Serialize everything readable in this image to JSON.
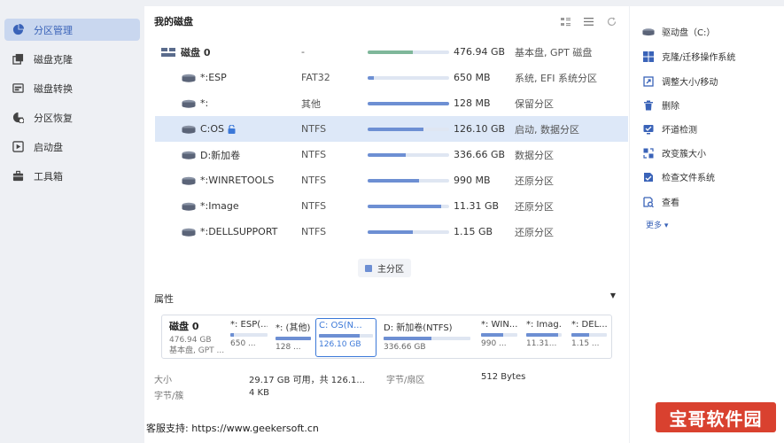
{
  "sidebar": {
    "items": [
      {
        "label": "分区管理",
        "icon": "pie-chart-icon",
        "active": true
      },
      {
        "label": "磁盘克隆",
        "icon": "clone-icon",
        "active": false
      },
      {
        "label": "磁盘转换",
        "icon": "convert-icon",
        "active": false
      },
      {
        "label": "分区恢复",
        "icon": "recover-icon",
        "active": false
      },
      {
        "label": "启动盘",
        "icon": "boot-disk-icon",
        "active": false
      },
      {
        "label": "工具箱",
        "icon": "toolbox-icon",
        "active": false
      }
    ]
  },
  "main": {
    "title": "我的磁盘",
    "toolbar_icons": [
      "grid-view-icon",
      "list-view-icon",
      "refresh-icon"
    ],
    "disk": {
      "name": "磁盘 0",
      "fs": "-",
      "size": "476.94 GB",
      "type": "基本盘, GPT 磁盘",
      "usage": 0.55
    },
    "partitions": [
      {
        "name": "*:ESP",
        "fs": "FAT32",
        "size": "650 MB",
        "type": "系统, EFI 系统分区",
        "usage": 0.08,
        "locked": false
      },
      {
        "name": "*:",
        "fs": "其他",
        "size": "128 MB",
        "type": "保留分区",
        "usage": 1.0,
        "locked": false
      },
      {
        "name": "C:OS",
        "fs": "NTFS",
        "size": "126.10 GB",
        "type": "启动, 数据分区",
        "usage": 0.68,
        "locked": true
      },
      {
        "name": "D:新加卷",
        "fs": "NTFS",
        "size": "336.66 GB",
        "type": "数据分区",
        "usage": 0.47,
        "locked": false
      },
      {
        "name": "*:WINRETOOLS",
        "fs": "NTFS",
        "size": "990 MB",
        "type": "还原分区",
        "usage": 0.63,
        "locked": false
      },
      {
        "name": "*:Image",
        "fs": "NTFS",
        "size": "11.31 GB",
        "type": "还原分区",
        "usage": 0.9,
        "locked": false
      },
      {
        "name": "*:DELLSUPPORT",
        "fs": "NTFS",
        "size": "1.15 GB",
        "type": "还原分区",
        "usage": 0.55,
        "locked": false
      }
    ],
    "legend": "主分区",
    "properties_title": "属性",
    "diskmap": {
      "disk": {
        "name": "磁盘 0",
        "size": "476.94 GB",
        "type": "基本盘, GPT ..."
      },
      "parts": [
        {
          "label": "*: ESP(...",
          "size": "650 ...",
          "usage": 0.1
        },
        {
          "label": "*: (其他)",
          "size": "128 ...",
          "usage": 1.0
        },
        {
          "label": "C: OS(N...",
          "size": "126.10 GB",
          "usage": 0.75
        },
        {
          "label": "D: 新加卷(NTFS)",
          "size": "336.66 GB",
          "usage": 0.55
        },
        {
          "label": "*: WIN...",
          "size": "990 ...",
          "usage": 0.6
        },
        {
          "label": "*: Imag...",
          "size": "11.31...",
          "usage": 0.9
        },
        {
          "label": "*: DEL...",
          "size": "1.15 ...",
          "usage": 0.5
        }
      ]
    },
    "props": {
      "size_label": "大小",
      "size_value": "29.17 GB 可用，共 126.1...",
      "sector_label": "字节/扇区",
      "sector_value": "512 Bytes",
      "cluster_label": "字节/簇",
      "cluster_value": "4 KB"
    },
    "footer": "客服支持: https://www.geekersoft.cn"
  },
  "right": {
    "actions": [
      {
        "label": "驱动盘（C:）",
        "icon": "drive-icon"
      },
      {
        "label": "克隆/迁移操作系统",
        "icon": "windows-icon"
      },
      {
        "label": "调整大小/移动",
        "icon": "resize-icon"
      },
      {
        "label": "删除",
        "icon": "trash-icon"
      },
      {
        "label": "坏道检测",
        "icon": "bad-sector-icon"
      },
      {
        "label": "改变簇大小",
        "icon": "cluster-icon"
      },
      {
        "label": "检查文件系统",
        "icon": "check-fs-icon"
      },
      {
        "label": "查看",
        "icon": "view-icon"
      }
    ],
    "more": "更多 ▾"
  },
  "watermark": "宝哥软件园",
  "colors": {
    "accent": "#3b78d8",
    "bar": "#6d8fd3",
    "selected_row": "#dde8f8",
    "watermark": "#d9412f"
  }
}
